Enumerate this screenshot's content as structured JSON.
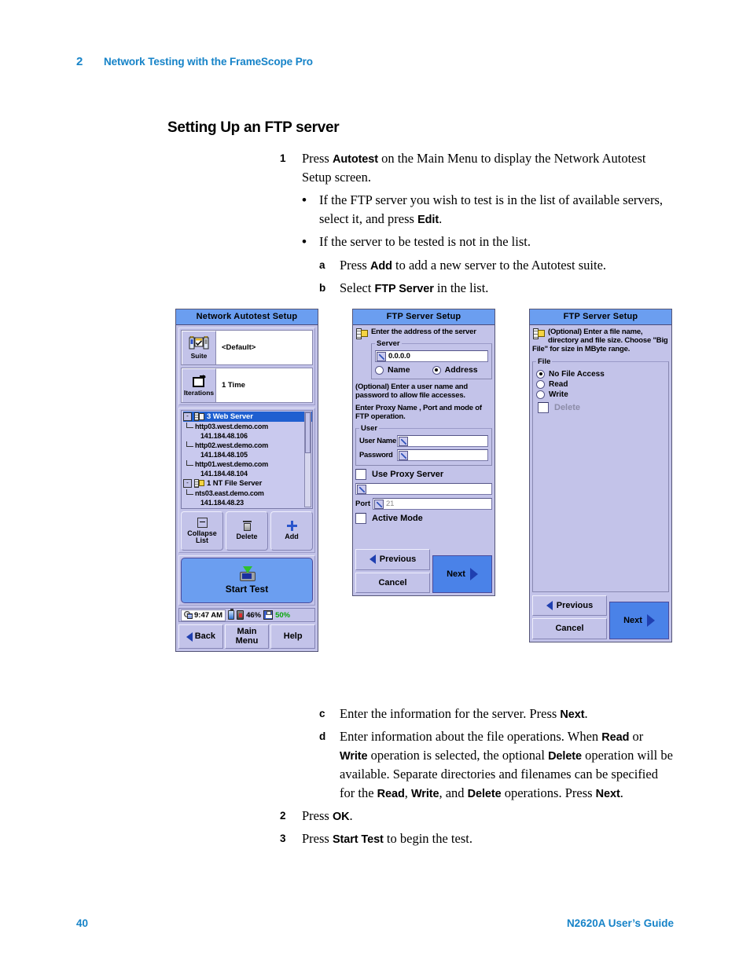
{
  "header": {
    "chapter_number": "2",
    "chapter_title": "Network Testing with the FrameScope Pro"
  },
  "section_heading": "Setting Up an FTP server",
  "steps_top": [
    {
      "marker": "1",
      "level": 1,
      "parts": [
        {
          "t": "Press ",
          "b": false
        },
        {
          "t": "Autotest",
          "b": true
        },
        {
          "t": " on the Main Menu to display the Network Autotest Setup screen.",
          "b": false
        }
      ]
    },
    {
      "marker": "•",
      "level": 2,
      "parts": [
        {
          "t": "If the FTP server you wish to test is in the list of available servers, select it, and press ",
          "b": false
        },
        {
          "t": "Edit",
          "b": true
        },
        {
          "t": ".",
          "b": false
        }
      ]
    },
    {
      "marker": "•",
      "level": 2,
      "parts": [
        {
          "t": "If the server to be tested is not in the list.",
          "b": false
        }
      ]
    },
    {
      "marker": "a",
      "level": 3,
      "parts": [
        {
          "t": "Press ",
          "b": false
        },
        {
          "t": "Add",
          "b": true
        },
        {
          "t": " to add a new server to the Autotest suite.",
          "b": false
        }
      ]
    },
    {
      "marker": "b",
      "level": 3,
      "parts": [
        {
          "t": "Select ",
          "b": false
        },
        {
          "t": "FTP Server",
          "b": true
        },
        {
          "t": " in the list.",
          "b": false
        }
      ]
    }
  ],
  "steps_bottom": [
    {
      "marker": "c",
      "level": 3,
      "parts": [
        {
          "t": "Enter the information for the server. Press ",
          "b": false
        },
        {
          "t": "Next",
          "b": true
        },
        {
          "t": ".",
          "b": false
        }
      ]
    },
    {
      "marker": "d",
      "level": 3,
      "parts": [
        {
          "t": "Enter information about the file operations. When ",
          "b": false
        },
        {
          "t": "Read",
          "b": true
        },
        {
          "t": " or ",
          "b": false
        },
        {
          "t": "Write",
          "b": true
        },
        {
          "t": " operation is selected, the optional ",
          "b": false
        },
        {
          "t": "Delete",
          "b": true
        },
        {
          "t": " operation will be available. Separate directories and filenames can be specified for the ",
          "b": false
        },
        {
          "t": "Read",
          "b": true
        },
        {
          "t": ", ",
          "b": false
        },
        {
          "t": "Write",
          "b": true
        },
        {
          "t": ", and ",
          "b": false
        },
        {
          "t": "Delete",
          "b": true
        },
        {
          "t": " operations. Press ",
          "b": false
        },
        {
          "t": "Next",
          "b": true
        },
        {
          "t": ".",
          "b": false
        }
      ]
    },
    {
      "marker": "2",
      "level": 1,
      "parts": [
        {
          "t": "Press ",
          "b": false
        },
        {
          "t": "OK",
          "b": true
        },
        {
          "t": ".",
          "b": false
        }
      ]
    },
    {
      "marker": "3",
      "level": 1,
      "parts": [
        {
          "t": "Press ",
          "b": false
        },
        {
          "t": "Start Test",
          "b": true
        },
        {
          "t": " to begin the test.",
          "b": false
        }
      ]
    }
  ],
  "device1": {
    "title": "Network Autotest Setup",
    "suite": {
      "label": "Suite",
      "value": "<Default>",
      "icon": "suite-icon"
    },
    "iterations": {
      "label": "Iterations",
      "value": "1 Time",
      "icon": "iterations-icon"
    },
    "tree": [
      {
        "type": "group",
        "expander": "-",
        "label": "3 Web Server",
        "selected": true,
        "icon": "web-server-icon"
      },
      {
        "type": "host",
        "label": "http03.west.demo.com"
      },
      {
        "type": "ip",
        "label": "141.184.48.106"
      },
      {
        "type": "host",
        "label": "http02.west.demo.com"
      },
      {
        "type": "ip",
        "label": "141.184.48.105"
      },
      {
        "type": "host",
        "label": "http01.west.demo.com"
      },
      {
        "type": "ip",
        "label": "141.184.48.104"
      },
      {
        "type": "group",
        "expander": "-",
        "label": "1 NT File Server",
        "selected": false,
        "icon": "file-server-icon"
      },
      {
        "type": "host",
        "label": "nts03.east.demo.com"
      },
      {
        "type": "ip",
        "label": "141.184.48.23"
      }
    ],
    "actions": [
      {
        "label": "Collapse List",
        "icon": "collapse-icon"
      },
      {
        "label": "Delete",
        "icon": "trash-icon"
      },
      {
        "label": "Add",
        "icon": "plus-icon"
      }
    ],
    "start_test": {
      "label": "Start Test",
      "icon": "start-test-icon"
    },
    "status": {
      "time": "9:47 AM",
      "battery_pct": "46%",
      "storage_pct": "50%",
      "clock_icon": "clock-icon",
      "battery_icon": "battery-icon",
      "plug_icon": "power-icon",
      "disk_icon": "floppy-disk-icon"
    },
    "nav": [
      {
        "label": "Back",
        "icon": "arrow-left-icon"
      },
      {
        "label": "Main Menu",
        "icon": ""
      },
      {
        "label": "Help",
        "icon": ""
      }
    ]
  },
  "device2": {
    "title": "FTP Server Setup",
    "hint": "Enter the address of the server",
    "server_group": {
      "legend": "Server",
      "address_value": "0.0.0.0",
      "radios": [
        {
          "label": "Name",
          "selected": false
        },
        {
          "label": "Address",
          "selected": true
        }
      ]
    },
    "note1": "(Optional) Enter a user name and password to allow file accesses.",
    "note2": "Enter Proxy Name , Port  and mode of FTP operation.",
    "user_group": {
      "legend": "User",
      "fields": [
        {
          "label": "User Name",
          "value": ""
        },
        {
          "label": "Password",
          "value": ""
        }
      ]
    },
    "use_proxy": {
      "label": "Use Proxy Server",
      "checked": false
    },
    "proxy_value": "",
    "port": {
      "label": "Port",
      "value": "21"
    },
    "active_mode": {
      "label": "Active Mode",
      "checked": false
    },
    "buttons": {
      "previous": "Previous",
      "cancel": "Cancel",
      "next": "Next"
    }
  },
  "device3": {
    "title": "FTP Server Setup",
    "hint": "(Optional) Enter a file name, directory and file size.  Choose \"Big File\" for size in MByte range.",
    "file_group": {
      "legend": "File",
      "radios": [
        {
          "label": "No File Access",
          "selected": true
        },
        {
          "label": "Read",
          "selected": false
        },
        {
          "label": "Write",
          "selected": false
        }
      ],
      "delete_checkbox": {
        "label": "Delete",
        "checked": false,
        "disabled": true
      }
    },
    "buttons": {
      "previous": "Previous",
      "cancel": "Cancel",
      "next": "Next"
    }
  },
  "footer": {
    "page_number": "40",
    "guide_title": "N2620A User’s Guide"
  },
  "colors": {
    "accent_blue": "#1683c8",
    "titlebar_blue": "#6b9ef0",
    "panel_lavender": "#c3c3e9",
    "selection_blue": "#1f5fd0",
    "next_button_blue": "#4a82e8",
    "status_green": "#0aa80a"
  }
}
